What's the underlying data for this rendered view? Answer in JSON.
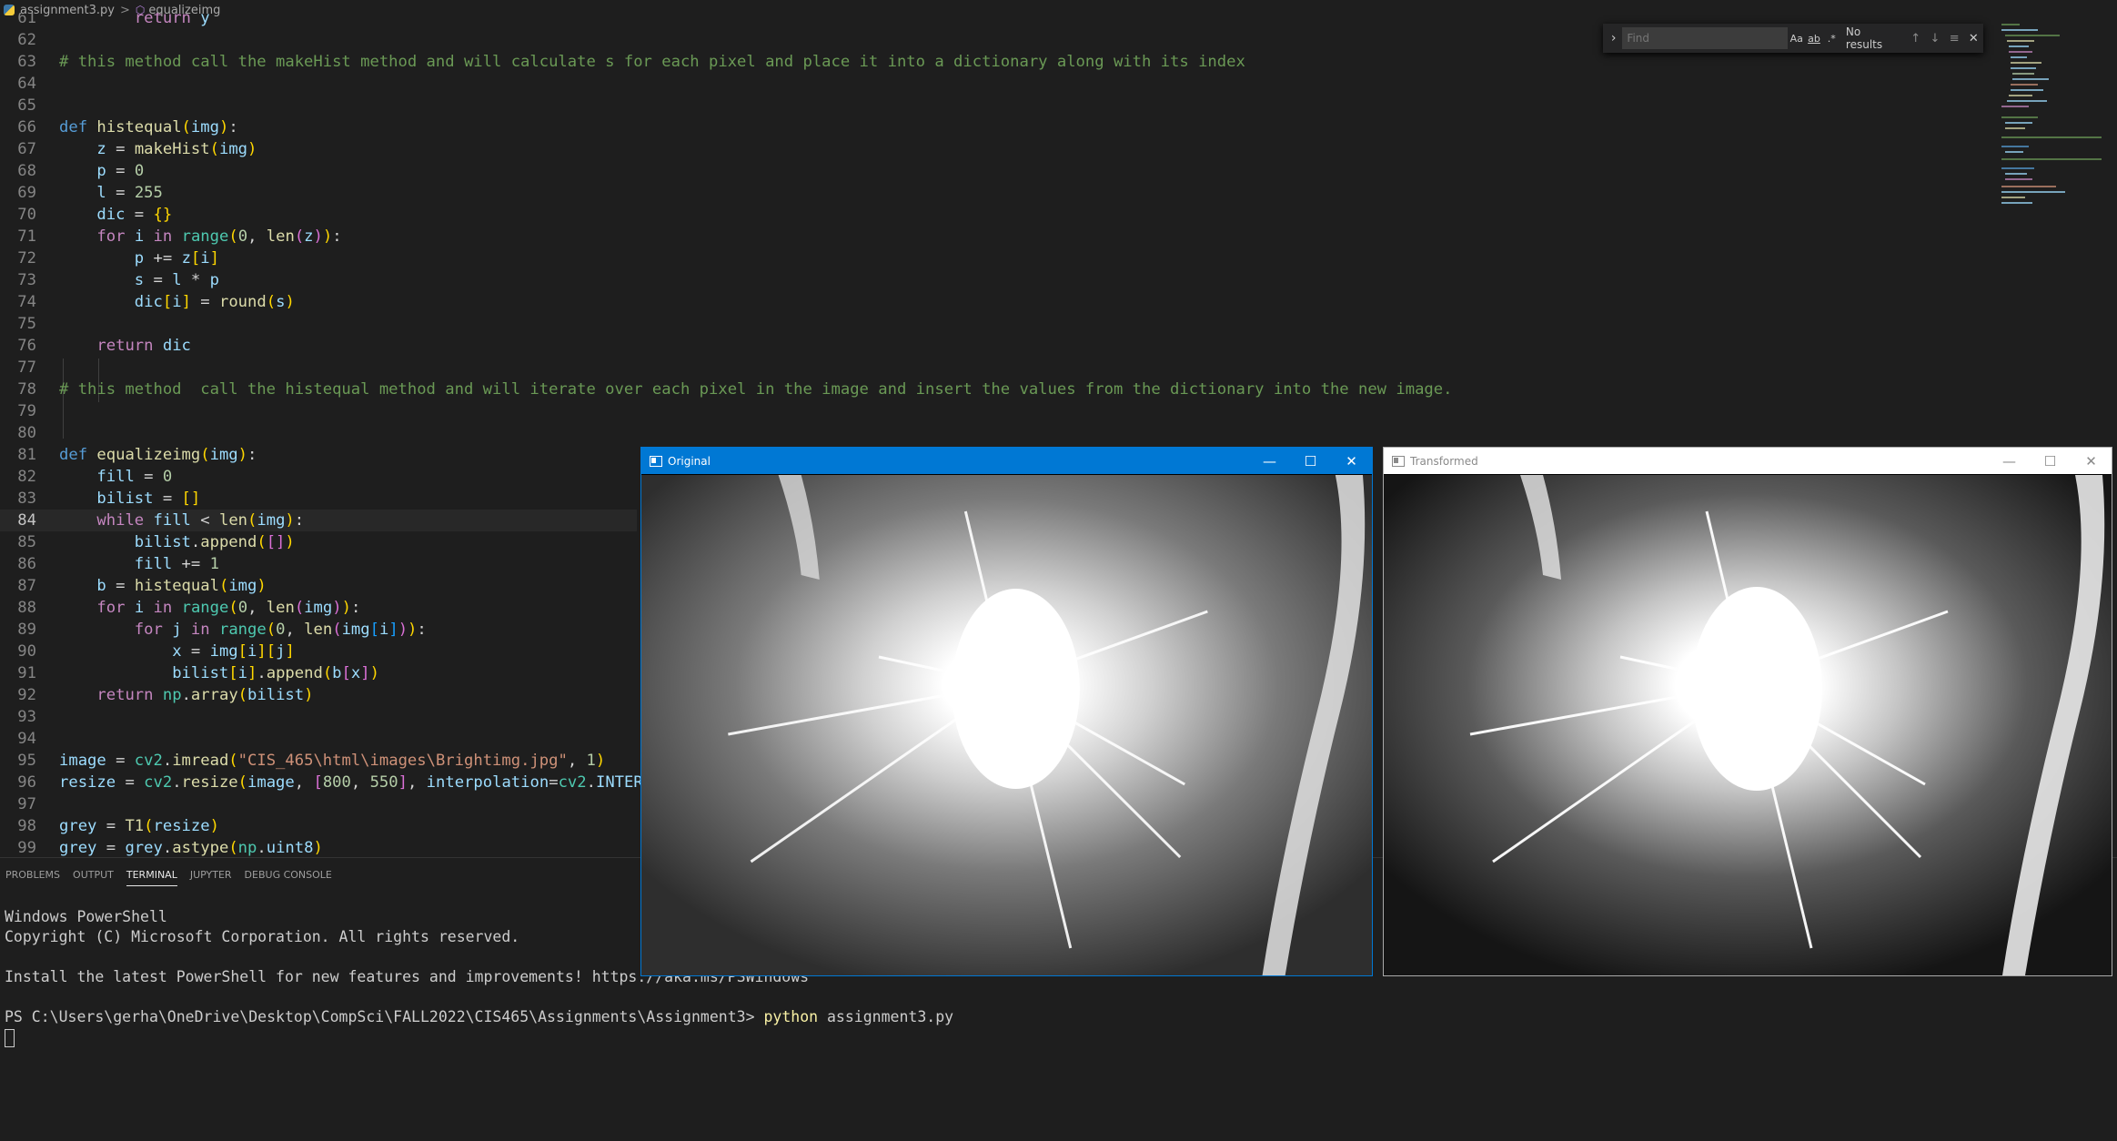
{
  "breadcrumb": {
    "file": "assignment3.py",
    "separator": ">",
    "symbol": "equalizeimg"
  },
  "find": {
    "placeholder": "Find",
    "opt_case": "Aa",
    "opt_word": "ab",
    "opt_regex": ".*",
    "results": "No results"
  },
  "panel": {
    "tabs": [
      "PROBLEMS",
      "OUTPUT",
      "TERMINAL",
      "JUPYTER",
      "DEBUG CONSOLE"
    ],
    "active_tab": "TERMINAL"
  },
  "terminal": {
    "line1": "Windows PowerShell",
    "line2": "Copyright (C) Microsoft Corporation. All rights reserved.",
    "line3": "Install the latest PowerShell for new features and improvements! https://aka.ms/PSWindows",
    "prompt": "PS C:\\Users\\gerha\\OneDrive\\Desktop\\CompSci\\FALL2022\\CIS465\\Assignments\\Assignment3> ",
    "cmd": "python",
    "args": " assignment3.py"
  },
  "windows": {
    "original_title": "Original",
    "transformed_title": "Transformed",
    "minimize": "—",
    "maximize": "☐",
    "close": "✕"
  },
  "code": {
    "l61": "61",
    "l61_ret": "return",
    "l61_y": "y",
    "l62": "62",
    "l63": "63",
    "l63_c": "# this method call the makeHist method and will calculate s for each pixel and place it into a dictionary along with its index",
    "l64": "64",
    "l65": "65",
    "l66": "66",
    "l66_def": "def",
    "l66_fn": "histequal",
    "l66_p": "img",
    "l67": "67",
    "l67_v": "z",
    "l67_fn": "makeHist",
    "l67_a": "img",
    "l68": "68",
    "l68_v": "p",
    "l68_n": "0",
    "l69": "69",
    "l69_v": "l",
    "l69_n": "255",
    "l70": "70",
    "l70_v": "dic",
    "l71": "71",
    "l71_for": "for",
    "l71_i": "i",
    "l71_in": "in",
    "l71_range": "range",
    "l71_0": "0",
    "l71_len": "len",
    "l71_z": "z",
    "l72": "72",
    "l72_p": "p",
    "l72_z": "z",
    "l72_i": "i",
    "l73": "73",
    "l73_s": "s",
    "l73_l": "l",
    "l73_p": "p",
    "l74": "74",
    "l74_dic": "dic",
    "l74_i": "i",
    "l74_round": "round",
    "l74_s": "s",
    "l75": "75",
    "l76": "76",
    "l76_ret": "return",
    "l76_dic": "dic",
    "l77": "77",
    "l78": "78",
    "l78_c": "# this method  call the histequal method and will iterate over each pixel in the image and insert the values from the dictionary into the new image.",
    "l79": "79",
    "l80": "80",
    "l81": "81",
    "l81_def": "def",
    "l81_fn": "equalizeimg",
    "l81_p": "img",
    "l82": "82",
    "l82_v": "fill",
    "l82_n": "0",
    "l83": "83",
    "l83_v": "bilist",
    "l84": "84",
    "l84_while": "while",
    "l84_fill": "fill",
    "l84_len": "len",
    "l84_img": "img",
    "l85": "85",
    "l85_bl": "bilist",
    "l85_app": "append",
    "l86": "86",
    "l86_fill": "fill",
    "l86_n": "1",
    "l87": "87",
    "l87_b": "b",
    "l87_fn": "histequal",
    "l87_img": "img",
    "l88": "88",
    "l88_for": "for",
    "l88_i": "i",
    "l88_in": "in",
    "l88_range": "range",
    "l88_0": "0",
    "l88_len": "len",
    "l88_img": "img",
    "l89": "89",
    "l89_for": "for",
    "l89_j": "j",
    "l89_in": "in",
    "l89_range": "range",
    "l89_0": "0",
    "l89_len": "len",
    "l89_img": "img",
    "l89_i": "i",
    "l90": "90",
    "l90_x": "x",
    "l90_img": "img",
    "l90_i": "i",
    "l90_j": "j",
    "l91": "91",
    "l91_bl": "bilist",
    "l91_i": "i",
    "l91_app": "append",
    "l91_b": "b",
    "l91_x": "x",
    "l92": "92",
    "l92_ret": "return",
    "l92_np": "np",
    "l92_array": "array",
    "l92_bl": "bilist",
    "l93": "93",
    "l94": "94",
    "l95": "95",
    "l95_v": "image",
    "l95_cv": "cv2",
    "l95_fn": "imread",
    "l95_s": "\"CIS_465\\html\\images\\Brightimg.jpg\"",
    "l95_n": "1",
    "l96": "96",
    "l96_v": "resize",
    "l96_cv": "cv2",
    "l96_fn": "resize",
    "l96_img": "image",
    "l96_n1": "800",
    "l96_n2": "550",
    "l96_kw": "interpolation",
    "l96_cv2": "cv2",
    "l96_const": "INTER_AREA",
    "l97": "97",
    "l98": "98",
    "l98_v": "grey",
    "l98_fn": "T1",
    "l98_a": "resize",
    "l99": "99",
    "l99_v": "grey",
    "l99_g": "grey",
    "l99_fn": "astype",
    "l99_np": "np",
    "l99_t": "uint8"
  }
}
